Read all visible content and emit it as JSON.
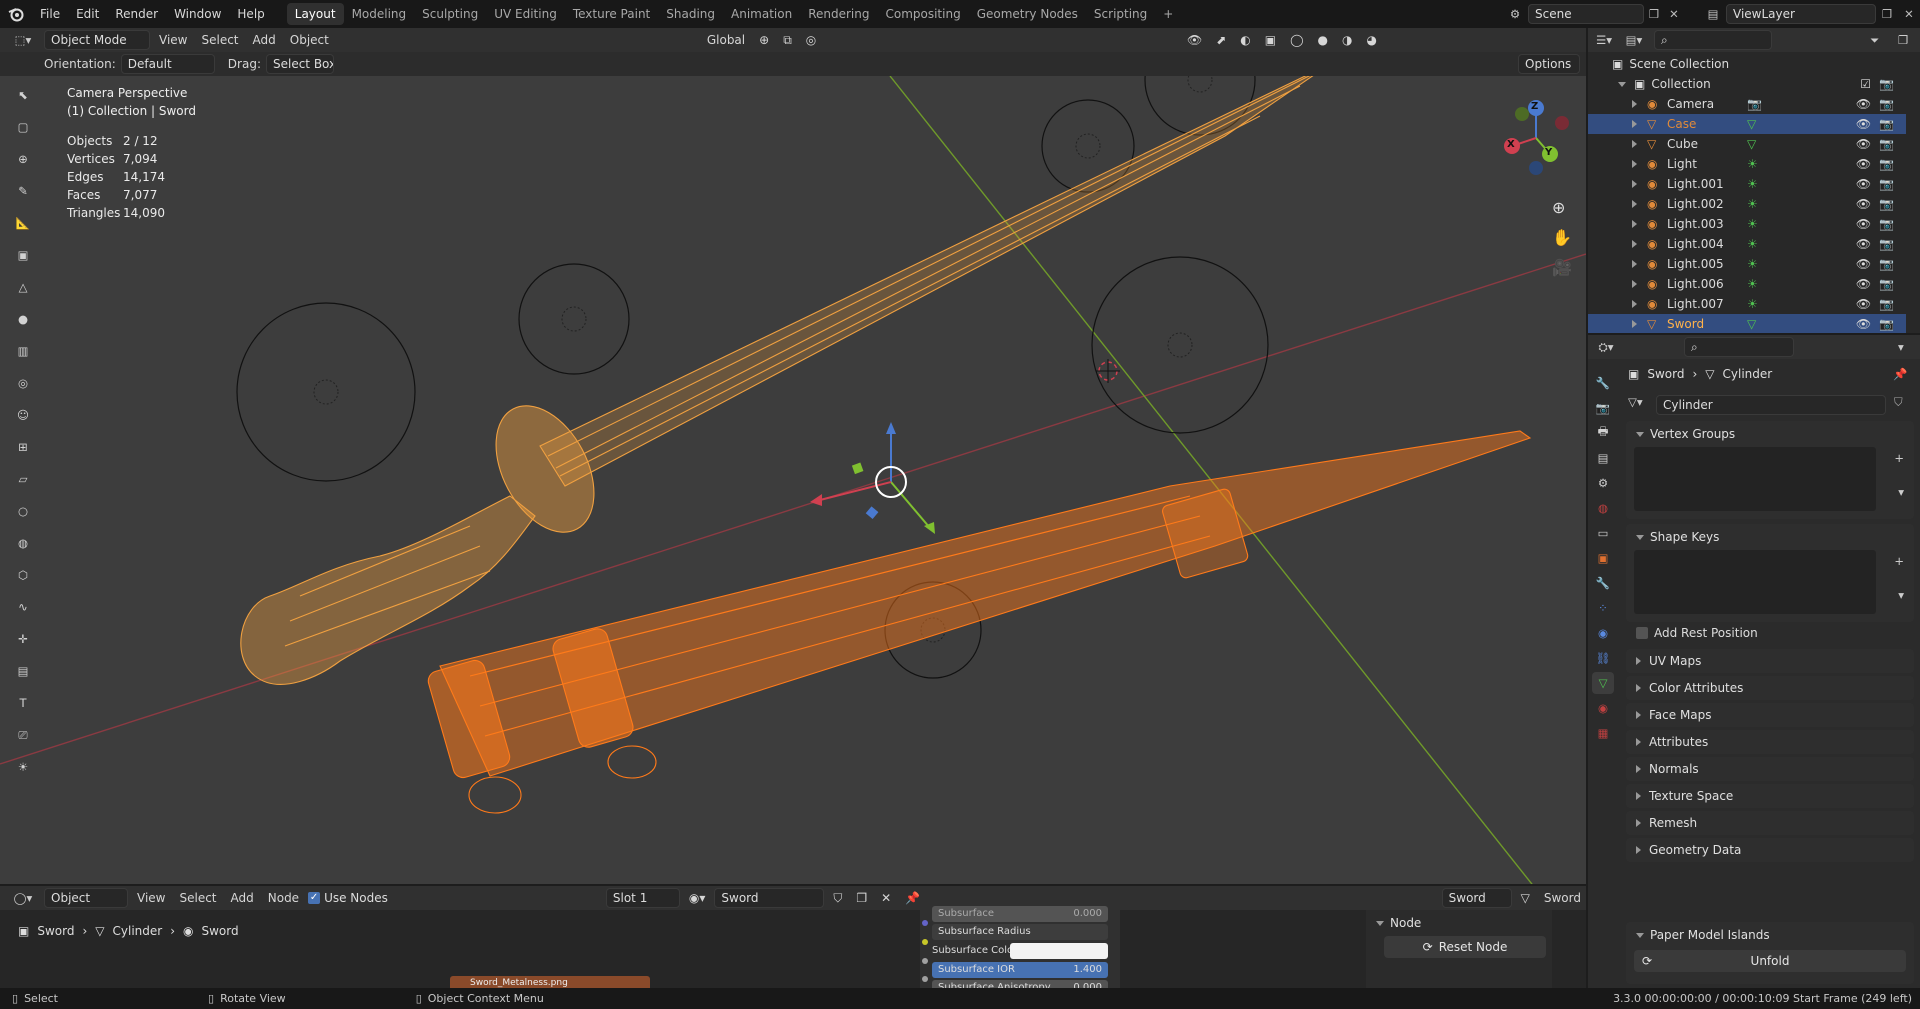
{
  "menu": {
    "items": [
      "File",
      "Edit",
      "Render",
      "Window",
      "Help"
    ]
  },
  "workspaces": [
    "Layout",
    "Modeling",
    "Sculpting",
    "UV Editing",
    "Texture Paint",
    "Shading",
    "Animation",
    "Rendering",
    "Compositing",
    "Geometry Nodes",
    "Scripting"
  ],
  "active_workspace": "Layout",
  "scene": {
    "name": "Scene",
    "view_layer": "ViewLayer"
  },
  "viewport_header": {
    "mode": "Object Mode",
    "menus": [
      "View",
      "Select",
      "Add",
      "Object"
    ],
    "transform": "Global",
    "orientation_label": "Orientation:",
    "orientation": "Default",
    "drag_label": "Drag:",
    "drag": "Select Box",
    "options": "Options"
  },
  "viewport": {
    "view_name": "Camera Perspective",
    "collection_line": "(1) Collection | Sword",
    "stats": [
      {
        "k": "Objects",
        "v": "2 / 12"
      },
      {
        "k": "Vertices",
        "v": "7,094"
      },
      {
        "k": "Edges",
        "v": "14,174"
      },
      {
        "k": "Faces",
        "v": "7,077"
      },
      {
        "k": "Triangles",
        "v": "14,090"
      }
    ]
  },
  "gizmo": {
    "x": "X",
    "y": "Y",
    "z": "Z"
  },
  "colors": {
    "selected_object": "#f0a040",
    "active_object": "#ff7a1a",
    "x_axis": "#d04050",
    "y_axis": "#80c030",
    "z_axis": "#4a7ad0",
    "accent": "#4772b3"
  },
  "outliner": {
    "root": "Scene Collection",
    "collection": "Collection",
    "items": [
      {
        "name": "Camera",
        "type": "camera",
        "sel": false
      },
      {
        "name": "Case",
        "type": "mesh",
        "sel": true
      },
      {
        "name": "Cube",
        "type": "mesh",
        "sel": false
      },
      {
        "name": "Light",
        "type": "light",
        "sel": false
      },
      {
        "name": "Light.001",
        "type": "light",
        "sel": false
      },
      {
        "name": "Light.002",
        "type": "light",
        "sel": false
      },
      {
        "name": "Light.003",
        "type": "light",
        "sel": false
      },
      {
        "name": "Light.004",
        "type": "light",
        "sel": false
      },
      {
        "name": "Light.005",
        "type": "light",
        "sel": false
      },
      {
        "name": "Light.006",
        "type": "light",
        "sel": false
      },
      {
        "name": "Light.007",
        "type": "light",
        "sel": false
      },
      {
        "name": "Sword",
        "type": "mesh",
        "sel": true
      }
    ]
  },
  "properties": {
    "breadcrumb_object": "Sword",
    "breadcrumb_data": "Cylinder",
    "mesh_name": "Cylinder",
    "vertex_groups": "Vertex Groups",
    "shape_keys": "Shape Keys",
    "add_rest_position": "Add Rest Position",
    "collapsed": [
      "UV Maps",
      "Color Attributes",
      "Face Maps",
      "Attributes",
      "Normals",
      "Texture Space",
      "Remesh",
      "Geometry Data"
    ],
    "paper_model": "Paper Model Islands",
    "unfold": "Unfold"
  },
  "shader_header": {
    "type": "Object",
    "menus": [
      "View",
      "Select",
      "Add",
      "Node"
    ],
    "use_nodes": "Use Nodes",
    "slot": "Slot 1",
    "material": "Sword",
    "right_obj": "Sword",
    "right_mat": "Sword"
  },
  "shader_breadcrumb": [
    "Sword",
    "Cylinder",
    "Sword"
  ],
  "node": {
    "rows": [
      "Subsurface",
      "Subsurface Radius",
      "Subsurface Color",
      "Subsurface IOR",
      "Subsurface Anisotropy"
    ],
    "ior": "1.400",
    "anis": "0.000",
    "sub": "0.000",
    "tex": "Sword_Metalness.png",
    "side_title": "Node",
    "reset": "Reset Node"
  },
  "statusbar": {
    "left": "Select",
    "mid": "Rotate View",
    "right_ctx": "Object Context Menu",
    "info": "3.3.0  00:00:00:00 / 00:00:10:09  Start Frame (249 left)"
  }
}
